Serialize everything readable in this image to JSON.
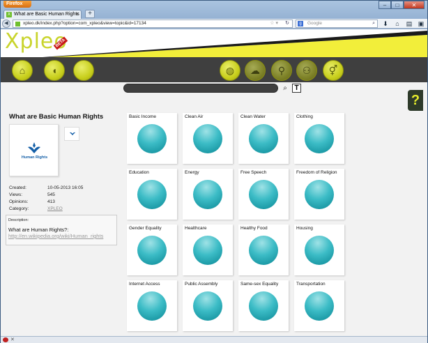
{
  "browser": {
    "menu_label": "Firefox",
    "tab_title": "What are Basic Human Rights",
    "tab_close": "×",
    "new_tab": "+",
    "url": "xpleo.dk/index.php?option=com_xpleo&view=topic&id=17134",
    "search_placeholder": "Google",
    "controls": {
      "minimize": "–",
      "maximize": "□",
      "close": "✕"
    }
  },
  "site": {
    "logo": "Xpleo",
    "beta": "BETA",
    "colors": {
      "accent": "#c8cf1c",
      "dark_bar": "#3f3f3f",
      "circle": "#3cbcc6"
    },
    "search_go_icon": "⌕",
    "text_toggle": "T",
    "help": "?"
  },
  "topic": {
    "title": "What are Basic Human Rights",
    "image_caption": "Human Rights",
    "meta": [
      {
        "key": "Created:",
        "value": "10-05-2013 16:05"
      },
      {
        "key": "Views:",
        "value": "545"
      },
      {
        "key": "Opinions:",
        "value": "413"
      },
      {
        "key": "Category:",
        "value": "XPLEO"
      }
    ],
    "description_label": "Description:",
    "description_question": "What are Human Rights?:",
    "description_link": "http://en.wikipedia.org/wiki/Human_rights"
  },
  "cards": [
    "Basic Income",
    "Clean Air",
    "Clean Water",
    "Clothing",
    "Education",
    "Energy",
    "Free Speech",
    "Freedom of Religion",
    "Gender Equality",
    "Healthcare",
    "Healthy Food",
    "Housing",
    "Internet Access",
    "Public Assembly",
    "Same-sex Equality",
    "Transportation"
  ]
}
